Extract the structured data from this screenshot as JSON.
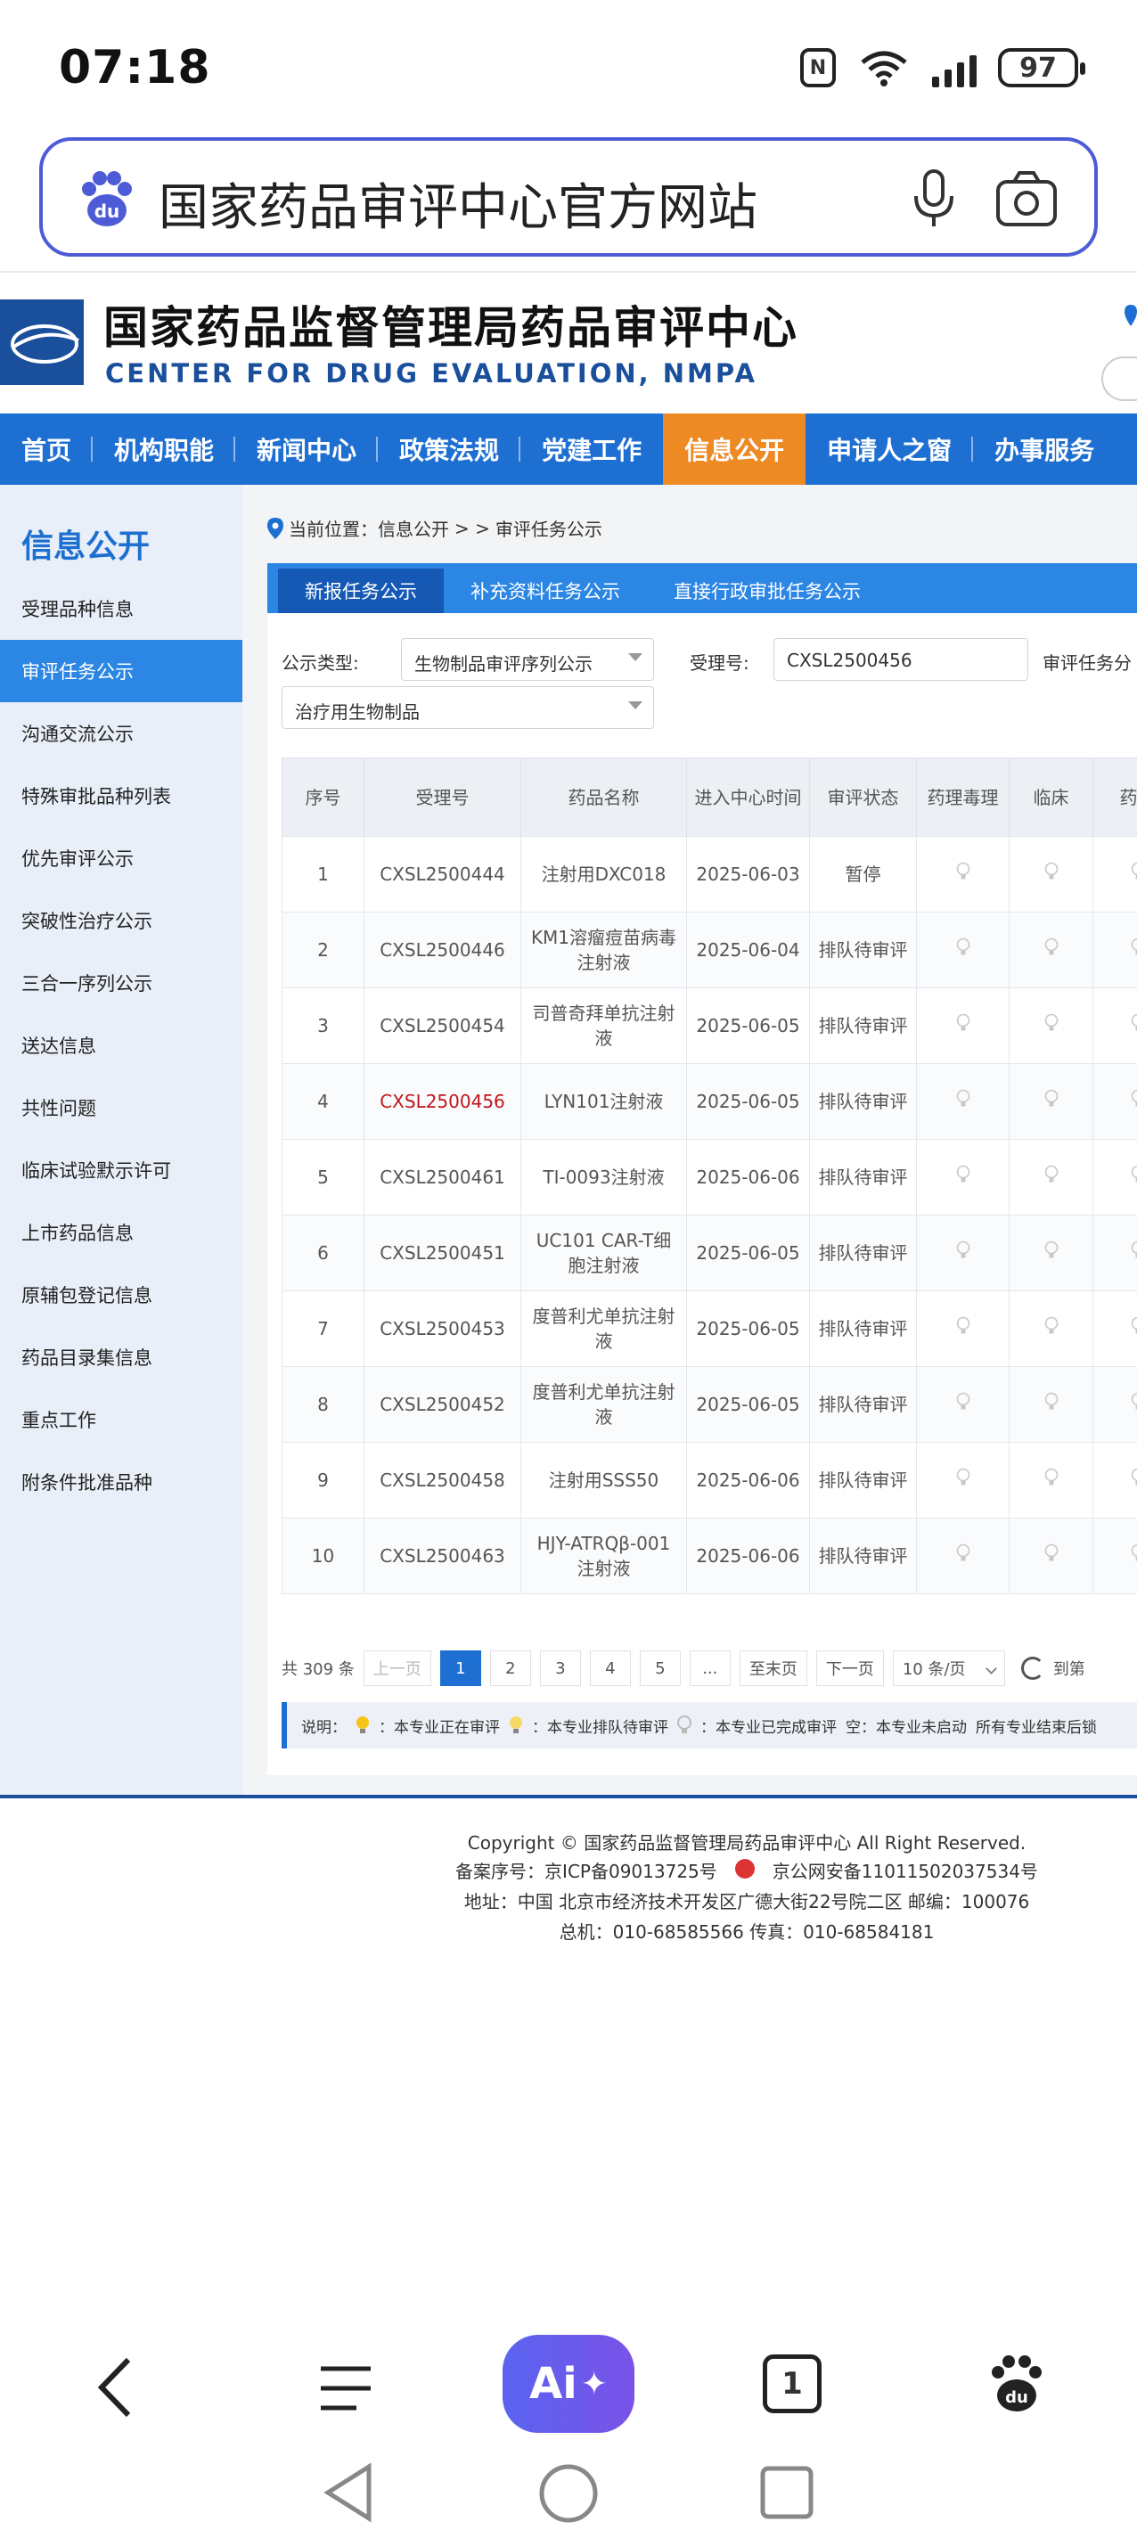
{
  "status_bar": {
    "time": "07:18",
    "nfc_label": "N",
    "battery": "97"
  },
  "search": {
    "query": "国家药品审评中心官方网站"
  },
  "site": {
    "name_cn": "国家药品监督管理局药品审评中心",
    "name_en": "CENTER FOR DRUG EVALUATION, NMPA"
  },
  "main_nav": [
    {
      "label": "首页"
    },
    {
      "label": "机构职能"
    },
    {
      "label": "新闻中心"
    },
    {
      "label": "政策法规"
    },
    {
      "label": "党建工作"
    },
    {
      "label": "信息公开",
      "active": true
    },
    {
      "label": "申请人之窗"
    },
    {
      "label": "办事服务"
    }
  ],
  "sidebar": {
    "title": "信息公开",
    "items": [
      {
        "label": "受理品种信息"
      },
      {
        "label": "审评任务公示",
        "active": true
      },
      {
        "label": "沟通交流公示"
      },
      {
        "label": "特殊审批品种列表"
      },
      {
        "label": "优先审评公示"
      },
      {
        "label": "突破性治疗公示"
      },
      {
        "label": "三合一序列公示"
      },
      {
        "label": "送达信息"
      },
      {
        "label": "共性问题"
      },
      {
        "label": "临床试验默示许可"
      },
      {
        "label": "上市药品信息"
      },
      {
        "label": "原辅包登记信息"
      },
      {
        "label": "药品目录集信息"
      },
      {
        "label": "重点工作"
      },
      {
        "label": "附条件批准品种"
      }
    ]
  },
  "breadcrumb": {
    "prefix": "当前位置：信息公开",
    "sep": "> >",
    "current": "审评任务公示"
  },
  "tabs": [
    {
      "label": "新报任务公示",
      "active": true
    },
    {
      "label": "补充资料任务公示"
    },
    {
      "label": "直接行政审批任务公示"
    }
  ],
  "filters": {
    "type_label": "公示类型:",
    "type_value": "生物制品审评序列公示",
    "accept_label": "受理号:",
    "accept_value": "CXSL2500456",
    "task_label": "审评任务分",
    "category_value": "治疗用生物制品"
  },
  "table": {
    "headers": [
      "序号",
      "受理号",
      "药品名称",
      "进入中心时间",
      "审评状态",
      "药理毒理",
      "临床",
      "药学"
    ],
    "rows": [
      {
        "no": "1",
        "accept": "CXSL2500444",
        "name": "注射用DXC018",
        "date": "2025-06-03",
        "status": "暂停"
      },
      {
        "no": "2",
        "accept": "CXSL2500446",
        "name": "KM1溶瘤痘苗病毒注射液",
        "date": "2025-06-04",
        "status": "排队待审评"
      },
      {
        "no": "3",
        "accept": "CXSL2500454",
        "name": "司普奇拜单抗注射液",
        "date": "2025-06-05",
        "status": "排队待审评"
      },
      {
        "no": "4",
        "accept": "CXSL2500456",
        "name": "LYN101注射液",
        "date": "2025-06-05",
        "status": "排队待审评",
        "highlight": true
      },
      {
        "no": "5",
        "accept": "CXSL2500461",
        "name": "TI-0093注射液",
        "date": "2025-06-06",
        "status": "排队待审评"
      },
      {
        "no": "6",
        "accept": "CXSL2500451",
        "name": "UC101 CAR-T细胞注射液",
        "date": "2025-06-05",
        "status": "排队待审评"
      },
      {
        "no": "7",
        "accept": "CXSL2500453",
        "name": "度普利尤单抗注射液",
        "date": "2025-06-05",
        "status": "排队待审评"
      },
      {
        "no": "8",
        "accept": "CXSL2500452",
        "name": "度普利尤单抗注射液",
        "date": "2025-06-05",
        "status": "排队待审评"
      },
      {
        "no": "9",
        "accept": "CXSL2500458",
        "name": "注射用SSS50",
        "date": "2025-06-06",
        "status": "排队待审评"
      },
      {
        "no": "10",
        "accept": "CXSL2500463",
        "name": "HJY-ATRQβ-001注射液",
        "date": "2025-06-06",
        "status": "排队待审评"
      }
    ]
  },
  "pager": {
    "total": "共 309 条",
    "prev": "上一页",
    "pages": [
      "1",
      "2",
      "3",
      "4",
      "5"
    ],
    "ellipsis": "...",
    "last": "至末页",
    "next": "下一页",
    "page_size": "10 条/页",
    "goto": "到第"
  },
  "legend": {
    "title": "说明：",
    "in_review": "：本专业正在审评",
    "queued": "：本专业排队待审评",
    "done": "：本专业已完成审评",
    "empty": "空：本专业未启动",
    "all_done": "所有专业结束后锁"
  },
  "footer": {
    "copyright": "Copyright © 国家药品监督管理局药品审评中心   All Right Reserved.",
    "icp": "备案序号：京ICP备09013725号",
    "police": "京公网安备11011502037534号",
    "address": "地址：中国 北京市经济技术开发区广德大街22号院二区     邮编：100076",
    "phone": "总机：010-68585566     传真：010-68584181"
  },
  "bottom_bar": {
    "ai_label": "Ai",
    "tab_count": "1"
  },
  "colors": {
    "nav_blue": "#1e6fd2",
    "nav_active": "#ee8a24",
    "highlight_red": "#c0161b"
  }
}
